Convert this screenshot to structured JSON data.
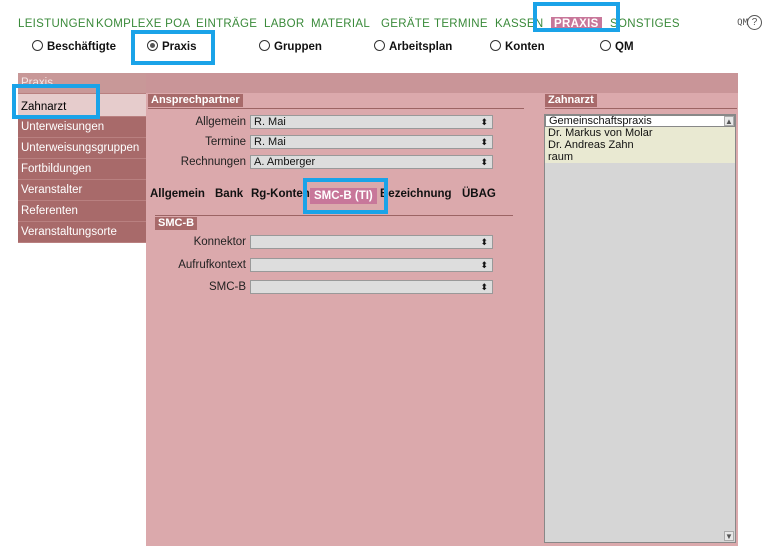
{
  "topmenu": {
    "items": [
      "LEISTUNGEN",
      "KOMPLEXE POA",
      "EINTRÄGE",
      "LABOR",
      "MATERIAL",
      "GERÄTE",
      "TERMINE",
      "KASSEN",
      "PRAXIS",
      "SONSTIGES"
    ],
    "right_label": "QM",
    "help_icon": "?"
  },
  "radios": [
    {
      "label": "Beschäftigte",
      "checked": false
    },
    {
      "label": "Praxis",
      "checked": true
    },
    {
      "label": "Gruppen",
      "checked": false
    },
    {
      "label": "Arbeitsplan",
      "checked": false
    },
    {
      "label": "Konten",
      "checked": false
    },
    {
      "label": "QM",
      "checked": false
    }
  ],
  "nav": {
    "header": "Praxis",
    "items": [
      "Zahnarzt",
      "Unterweisungen",
      "Unterweisungsgruppen",
      "Fortbildungen",
      "Veranstalter",
      "Referenten",
      "Veranstaltungsorte"
    ]
  },
  "ansprechpartner": {
    "title": "Ansprechpartner",
    "fields": [
      {
        "label": "Allgemein",
        "value": "R. Mai"
      },
      {
        "label": "Termine",
        "value": "R. Mai"
      },
      {
        "label": "Rechnungen",
        "value": "A. Amberger"
      }
    ]
  },
  "tabs": [
    "Allgemein",
    "Bank",
    "Rg-Konten",
    "SMC-B (TI)",
    "Bezeichnung",
    "ÜBAG"
  ],
  "smcb": {
    "title": "SMC-B",
    "fields": [
      {
        "label": "Konnektor",
        "value": ""
      },
      {
        "label": "Aufrufkontext",
        "value": ""
      },
      {
        "label": "SMC-B",
        "value": ""
      }
    ]
  },
  "zahnarzt": {
    "title": "Zahnarzt",
    "items": [
      "Gemeinschaftspraxis",
      "Dr. Markus von Molar",
      "Dr. Andreas Zahn",
      "raum"
    ]
  },
  "glyphs": {
    "select_arrow": "⬍",
    "scroll_up": "▲",
    "scroll_down": "▼"
  }
}
